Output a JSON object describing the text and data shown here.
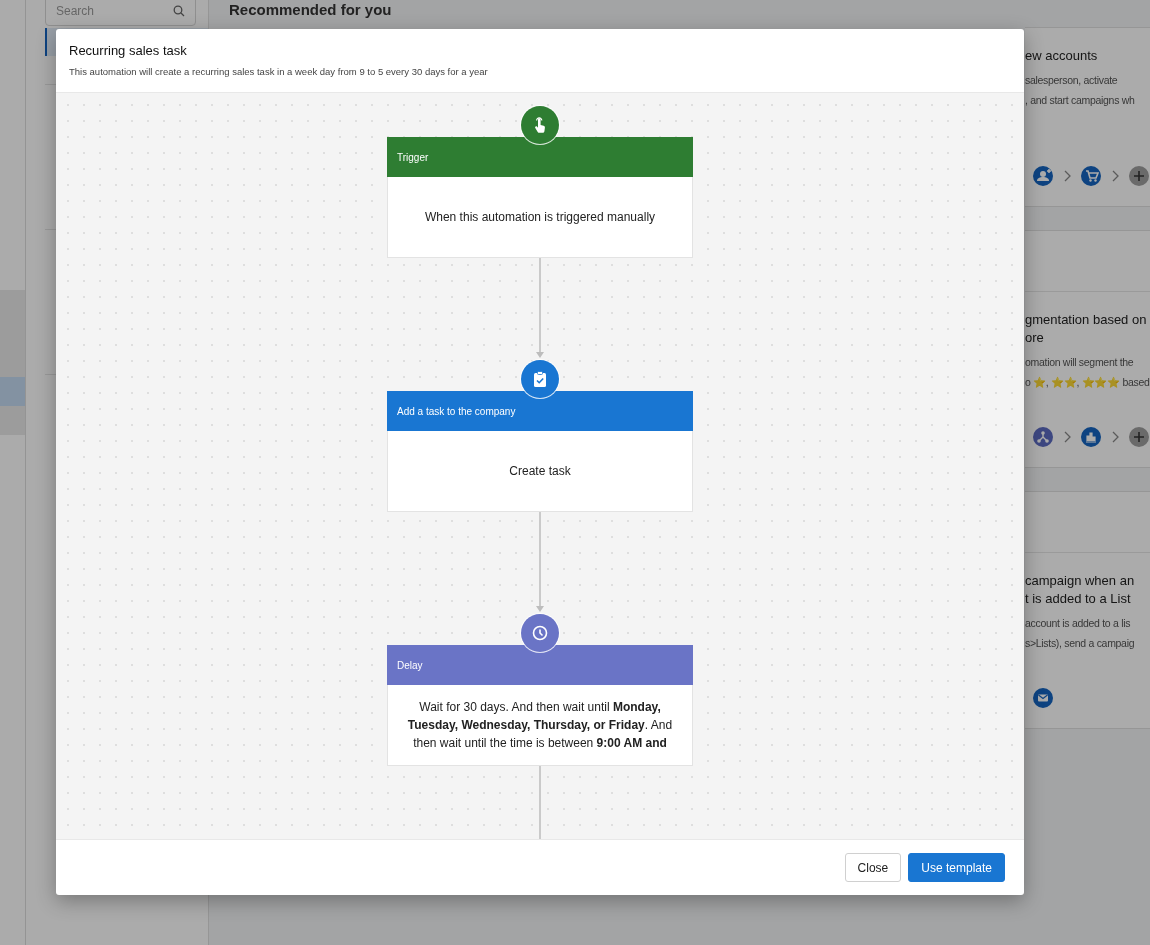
{
  "background": {
    "rail_items": [
      {
        "selected": false
      },
      {
        "selected": true
      },
      {
        "selected": false
      }
    ],
    "search": {
      "placeholder": "Search"
    },
    "sidebar_items": [
      {
        "kind": "link",
        "selected": true
      },
      {
        "kind": "link",
        "selected": false
      },
      {
        "kind": "section",
        "selected": false
      },
      {
        "kind": "section",
        "selected": false
      },
      {
        "kind": "section",
        "selected": false
      }
    ],
    "heading": "Recommended for you",
    "cards": [
      {
        "title_lines": [
          "ew accounts"
        ],
        "description_lines": [
          "salesperson, activate",
          ", and start campaigns wh"
        ],
        "steps": [
          {
            "kind": "person"
          },
          {
            "kind": "cart"
          },
          {
            "kind": "plus"
          }
        ]
      },
      {
        "title_lines": [
          "gmentation based on",
          "ore"
        ],
        "description_lines": [
          "omation will segment the",
          "o ⭐, ⭐⭐, ⭐⭐⭐ based"
        ],
        "steps": [
          {
            "kind": "hub"
          },
          {
            "kind": "chart"
          },
          {
            "kind": "plus"
          }
        ]
      },
      {
        "title_lines": [
          "campaign when an",
          "t is added to a List"
        ],
        "description_lines": [
          "account is added to a lis",
          "s>Lists), send a campaig"
        ],
        "steps": [
          {
            "kind": "mail"
          }
        ]
      }
    ]
  },
  "modal": {
    "title": "Recurring sales task",
    "subtitle": "This automation will create a recurring sales task in a week day from 9 to 5 every 30 days for a year",
    "steps": [
      {
        "kind": "trigger",
        "label": "Trigger",
        "text": "When this automation is triggered manually",
        "color": "#2e7d32"
      },
      {
        "kind": "task",
        "label": "Add a task to the company",
        "text": "Create task",
        "color": "#1976d2"
      },
      {
        "kind": "delay",
        "label": "Delay",
        "text": "Wait for 30 days. And then wait until **Monday, Tuesday, Wednesday, Thursday, or Friday**. And then wait until the time is between **9:00 AM and**",
        "color": "#6a74c6"
      }
    ],
    "buttons": [
      {
        "kind": "secondary",
        "label": "Close"
      },
      {
        "kind": "primary",
        "label": "Use template"
      }
    ]
  }
}
